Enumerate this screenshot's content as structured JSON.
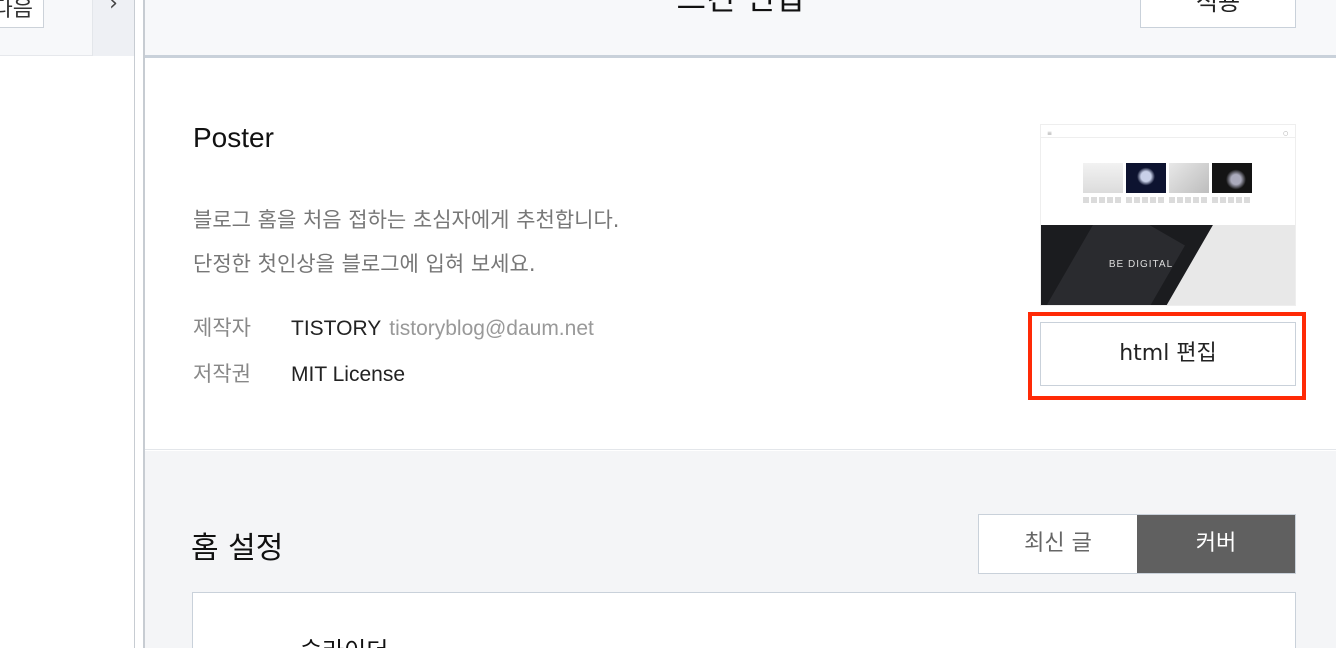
{
  "sidebar": {
    "button_label": "다음",
    "arrow_glyph": "›"
  },
  "header": {
    "title": "스킨 편집",
    "save_label": "적용"
  },
  "skin": {
    "name": "Poster",
    "description_lines": [
      "블로그 홈을 처음 접하는 초심자에게 추천합니다.",
      "단정한 첫인상을 블로그에 입혀 보세요."
    ],
    "author_label": "제작자",
    "author_name": "TISTORY",
    "author_email": "tistoryblog@daum.net",
    "license_label": "저작권",
    "license_value": "MIT License",
    "thumbnail_caption": "BE DIGITAL",
    "html_edit_label": "html 편집",
    "highlight_color": "#ff2a06"
  },
  "home_settings": {
    "title": "홈 설정",
    "toggle": {
      "options": [
        "최신 글",
        "커버"
      ],
      "selected": "커버"
    },
    "panel_item_label": "슬라이더"
  }
}
